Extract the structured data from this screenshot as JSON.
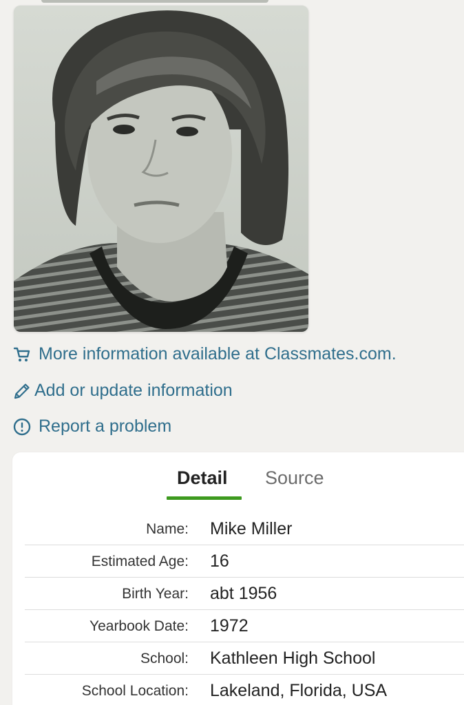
{
  "links": {
    "classmates": "More information available at Classmates.com.",
    "add_update": "Add or update information",
    "report": "Report a problem"
  },
  "icons": {
    "classmates": "cart-icon",
    "add_update": "pencil-icon",
    "report": "alert-circle-icon"
  },
  "tabs": {
    "detail": "Detail",
    "source": "Source",
    "active": "Detail"
  },
  "details": [
    {
      "label": "Name:",
      "value": "Mike Miller"
    },
    {
      "label": "Estimated Age:",
      "value": "16"
    },
    {
      "label": "Birth Year:",
      "value": "abt 1956"
    },
    {
      "label": "Yearbook Date:",
      "value": "1972"
    },
    {
      "label": "School:",
      "value": "Kathleen High School"
    },
    {
      "label": "School Location:",
      "value": "Lakeland, Florida, USA"
    }
  ],
  "colors": {
    "link": "#2f6e8c",
    "accent": "#3d9a1f",
    "background": "#f2f1ee"
  }
}
